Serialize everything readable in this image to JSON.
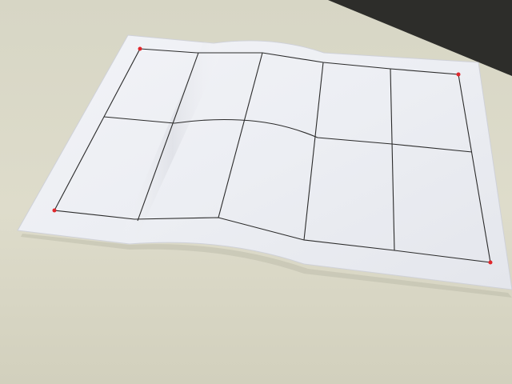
{
  "photo": {
    "subject": "",
    "colors": {
      "table_top": "#deddcc",
      "table_shadow": "#c9c7b5",
      "background_dark": "#2d2d2a",
      "paper": "#eef0f5",
      "paper_shade": "#d9dbe2",
      "grid_line": "#2b2b2b",
      "corner_marker": "#e0262b"
    }
  }
}
